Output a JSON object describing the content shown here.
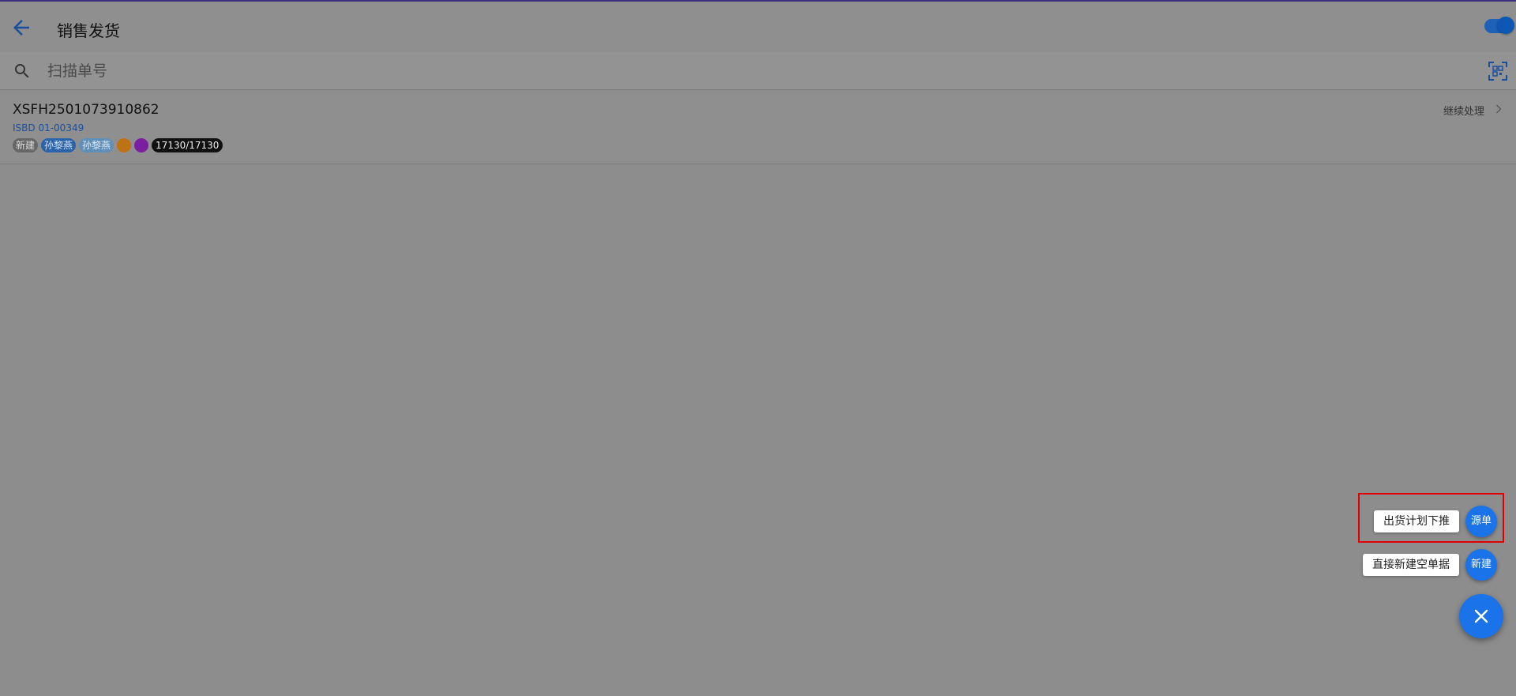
{
  "header": {
    "title": "销售发货",
    "toggle_on": true
  },
  "search": {
    "placeholder": "扫描单号",
    "value": ""
  },
  "list": {
    "items": [
      {
        "doc_no": "XSFH2501073910862",
        "source_no": "ISBD 01-00349",
        "status_tag": "新建",
        "user_tag_1": "孙黎燕",
        "user_tag_2": "孙黎燕",
        "dot_colors": [
          "#c07210",
          "#7b1fa2"
        ],
        "qty": "17130/17130",
        "action": "继续处理"
      }
    ]
  },
  "fab": {
    "option1_label": "出货计划下推",
    "option1_button": "源单",
    "option2_label": "直接新建空单据",
    "option2_button": "新建",
    "main_icon": "close-icon"
  },
  "colors": {
    "accent": "#1a73e8",
    "highlight": "#e00000",
    "overlay": "#8d8d8d"
  }
}
